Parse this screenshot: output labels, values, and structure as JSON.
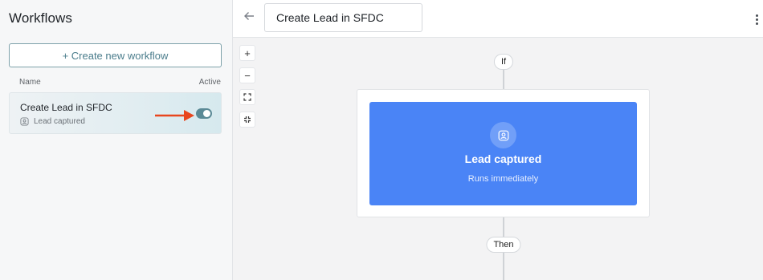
{
  "sidebar": {
    "title": "Workflows",
    "create_button_label": "+ Create new workflow",
    "columns": {
      "name": "Name",
      "active": "Active"
    },
    "workflows": [
      {
        "name": "Create Lead in SFDC",
        "trigger": "Lead captured",
        "trigger_icon": "user-badge-icon",
        "active": true
      }
    ]
  },
  "header": {
    "back_icon": "arrow-left-icon",
    "workflow_title": "Create Lead in SFDC",
    "menu_icon": "kebab-menu-icon"
  },
  "canvas": {
    "zoom_controls": {
      "zoom_in": "+",
      "zoom_out": "−",
      "fit_icon": "expand-icon",
      "collapse_icon": "collapse-icon"
    },
    "if_label": "If",
    "then_label": "Then",
    "trigger": {
      "title": "Lead captured",
      "subtitle": "Runs immediately",
      "icon": "user-badge-icon",
      "color": "#4a84f6"
    }
  },
  "annotation": {
    "arrow_color": "#e8461e"
  }
}
